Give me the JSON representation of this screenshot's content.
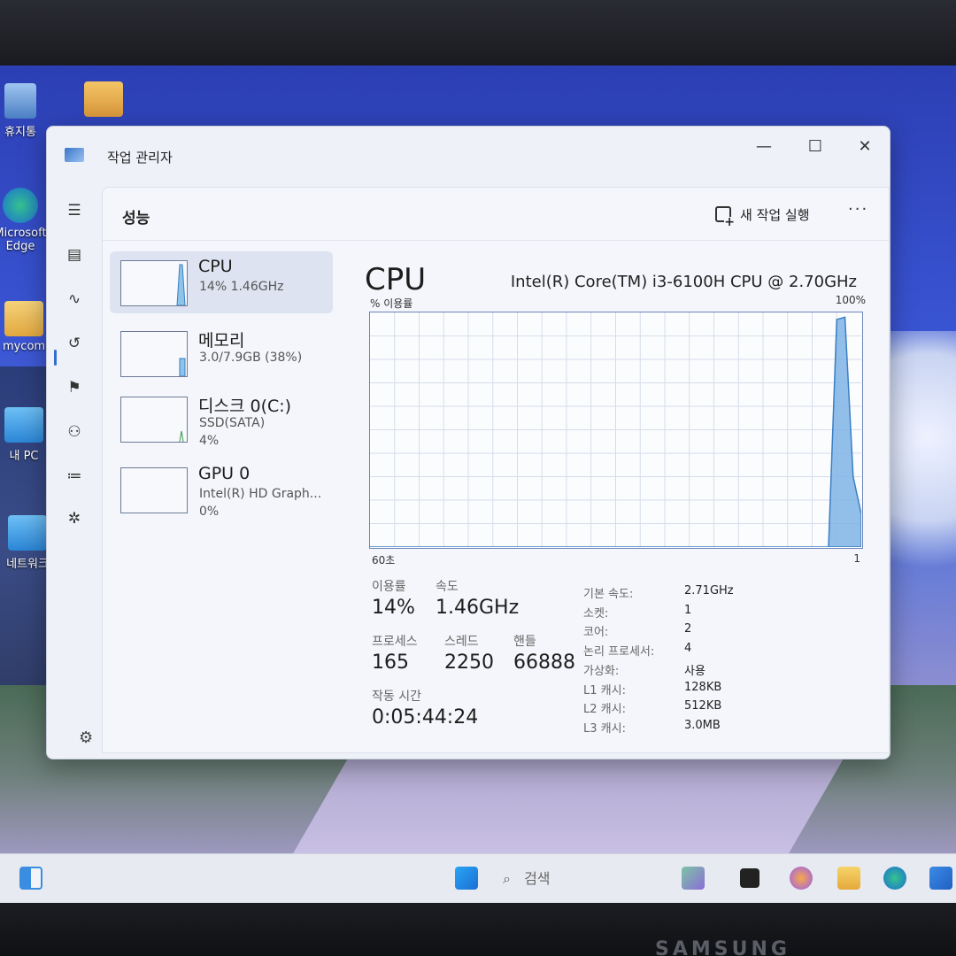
{
  "desktop": {
    "icons": [
      {
        "label": "휴지통"
      },
      {
        "label": "Microsoft Edge"
      },
      {
        "label": "mycom"
      },
      {
        "label": "내 PC"
      },
      {
        "label": "네트워크"
      }
    ]
  },
  "window": {
    "title": "작업 관리자",
    "minimize_glyph": "—",
    "maximize_glyph": "☐",
    "close_glyph": "✕"
  },
  "header": {
    "page_title": "성능",
    "run_task_label": "새 작업 실행",
    "more_glyph": "···"
  },
  "devices": [
    {
      "name": "CPU",
      "sub1": "14% 1.46GHz",
      "sub2": ""
    },
    {
      "name": "메모리",
      "sub1": "3.0/7.9GB (38%)",
      "sub2": ""
    },
    {
      "name": "디스크 0(C:)",
      "sub1": "SSD(SATA)",
      "sub2": "4%"
    },
    {
      "name": "GPU 0",
      "sub1": "Intel(R) HD Graph...",
      "sub2": "0%"
    }
  ],
  "detail": {
    "title": "CPU",
    "model": "Intel(R) Core(TM) i3-6100H CPU @ 2.70GHz",
    "y_label": "% 이용률",
    "y_max_label": "100%",
    "x_left_label": "60초",
    "x_right_label": "1",
    "stats": {
      "utilization_label": "이용률",
      "utilization": "14%",
      "speed_label": "속도",
      "speed": "1.46GHz",
      "processes_label": "프로세스",
      "processes": "165",
      "threads_label": "스레드",
      "threads": "2250",
      "handles_label": "핸들",
      "handles": "66888",
      "uptime_label": "작동 시간",
      "uptime": "0:05:44:24"
    },
    "specs": [
      {
        "key": "기본 속도:",
        "value": "2.71GHz"
      },
      {
        "key": "소켓:",
        "value": "1"
      },
      {
        "key": "코어:",
        "value": "2"
      },
      {
        "key": "논리 프로세서:",
        "value": "4"
      },
      {
        "key": "가상화:",
        "value": "사용"
      },
      {
        "key": "L1 캐시:",
        "value": "128KB"
      },
      {
        "key": "L2 캐시:",
        "value": "512KB"
      },
      {
        "key": "L3 캐시:",
        "value": "3.0MB"
      }
    ]
  },
  "taskbar": {
    "search_label": "검색"
  },
  "monitor": {
    "brand": "SAMSUNG"
  },
  "chart_data": {
    "type": "area",
    "y_range": [
      0,
      100
    ],
    "x_range_seconds": [
      60,
      0
    ],
    "series": [
      {
        "values": [
          0,
          0,
          0,
          0,
          0,
          0,
          0,
          0,
          0,
          0,
          0,
          0,
          0,
          0,
          0,
          0,
          0,
          0,
          0,
          0,
          0,
          0,
          0,
          0,
          0,
          0,
          0,
          0,
          0,
          0,
          0,
          0,
          0,
          0,
          0,
          0,
          0,
          0,
          0,
          0,
          0,
          0,
          0,
          0,
          0,
          0,
          0,
          0,
          0,
          0,
          0,
          0,
          0,
          0,
          0,
          0,
          0,
          97,
          98,
          30,
          14
        ]
      }
    ],
    "grid": true,
    "color": "#7fb3e6"
  }
}
